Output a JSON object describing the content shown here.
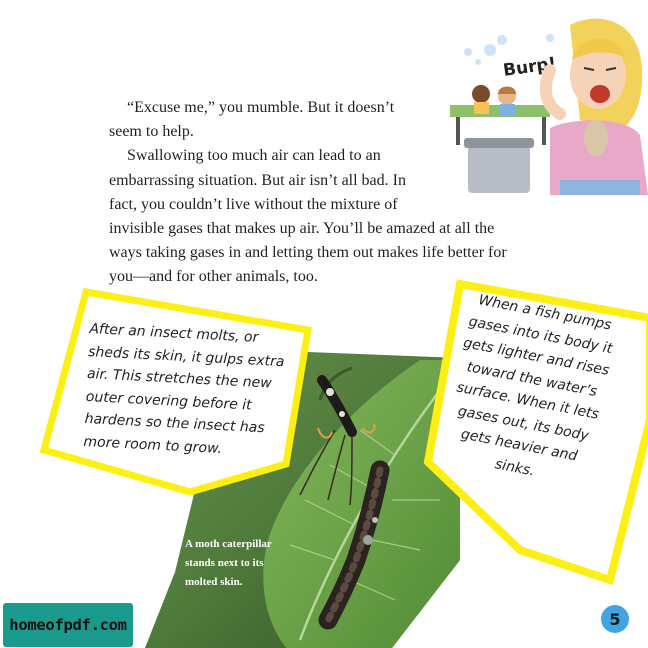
{
  "illustration": {
    "burp_text": "Burp!"
  },
  "body": {
    "paragraphs": [
      {
        "lines": [
          "“Excuse me,” you mumble. But it doesn’t",
          "seem to help."
        ]
      },
      {
        "lines": [
          "Swallowing too much air can lead to an",
          "embarrassing situation. But air isn’t all bad. In",
          "fact, you couldn’t live without the mixture of",
          "invisible gases that makes up air. You’ll be amazed at all the",
          "ways taking gases in and letting them out makes life better for",
          "you—and for other animals, too."
        ]
      }
    ]
  },
  "callout_left": {
    "lines": [
      "After an insect molts, or",
      "sheds its skin, it gulps extra",
      "air. This stretches the new",
      "outer covering before it",
      "hardens so the insect has",
      "more room to grow."
    ]
  },
  "callout_right": {
    "lines": [
      "When a fish pumps",
      "gases into its body it",
      "gets lighter and rises",
      "toward the water’s",
      "surface. When it lets",
      "gases out, its body",
      "gets heavier and",
      "sinks."
    ]
  },
  "photo": {
    "caption_lines": [
      "A moth caterpillar",
      "stands next to its",
      "molted skin."
    ]
  },
  "watermark": {
    "text": "homeofpdf.com"
  },
  "page_number": "5",
  "colors": {
    "callout_border": "#fcef13",
    "leaf_green": "#5a9a3a",
    "logo_bg": "#1a9a8c",
    "page_badge": "#3fa4df"
  }
}
